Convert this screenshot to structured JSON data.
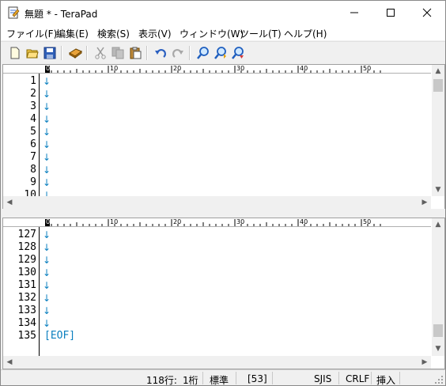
{
  "window": {
    "title": "無題 * - TeraPad",
    "minimize": "—",
    "maximize": "☐",
    "close": "✕"
  },
  "menu": [
    "ファイル(F)",
    "編集(E)",
    "検索(S)",
    "表示(V)",
    "ウィンドウ(W)",
    "ツール(T)",
    "ヘルプ(H)"
  ],
  "toolbar_icons": [
    "new-file-icon",
    "open-folder-icon",
    "save-icon",
    "print-icon",
    "cut-icon",
    "copy-icon",
    "paste-icon",
    "undo-icon",
    "redo-icon",
    "find-icon",
    "find-next-icon",
    "replace-icon"
  ],
  "ruler": {
    "marks": [
      "0",
      "10",
      "20",
      "30",
      "40",
      "50"
    ]
  },
  "top_pane": {
    "lines": [
      "1",
      "2",
      "3",
      "4",
      "5",
      "6",
      "7",
      "8",
      "9",
      "10"
    ],
    "newline_glyph": "↓"
  },
  "bottom_pane": {
    "lines": [
      "127",
      "128",
      "129",
      "130",
      "131",
      "132",
      "133",
      "134",
      "135"
    ],
    "newline_glyph": "↓",
    "eof": "[EOF]"
  },
  "status": {
    "lines": "118行:",
    "column": "1桁",
    "mode": "標準",
    "code": "[53]",
    "encoding": "SJIS",
    "newline": "CRLF",
    "insert": "挿入"
  },
  "colors": {
    "accent": "#0a7fbf"
  }
}
